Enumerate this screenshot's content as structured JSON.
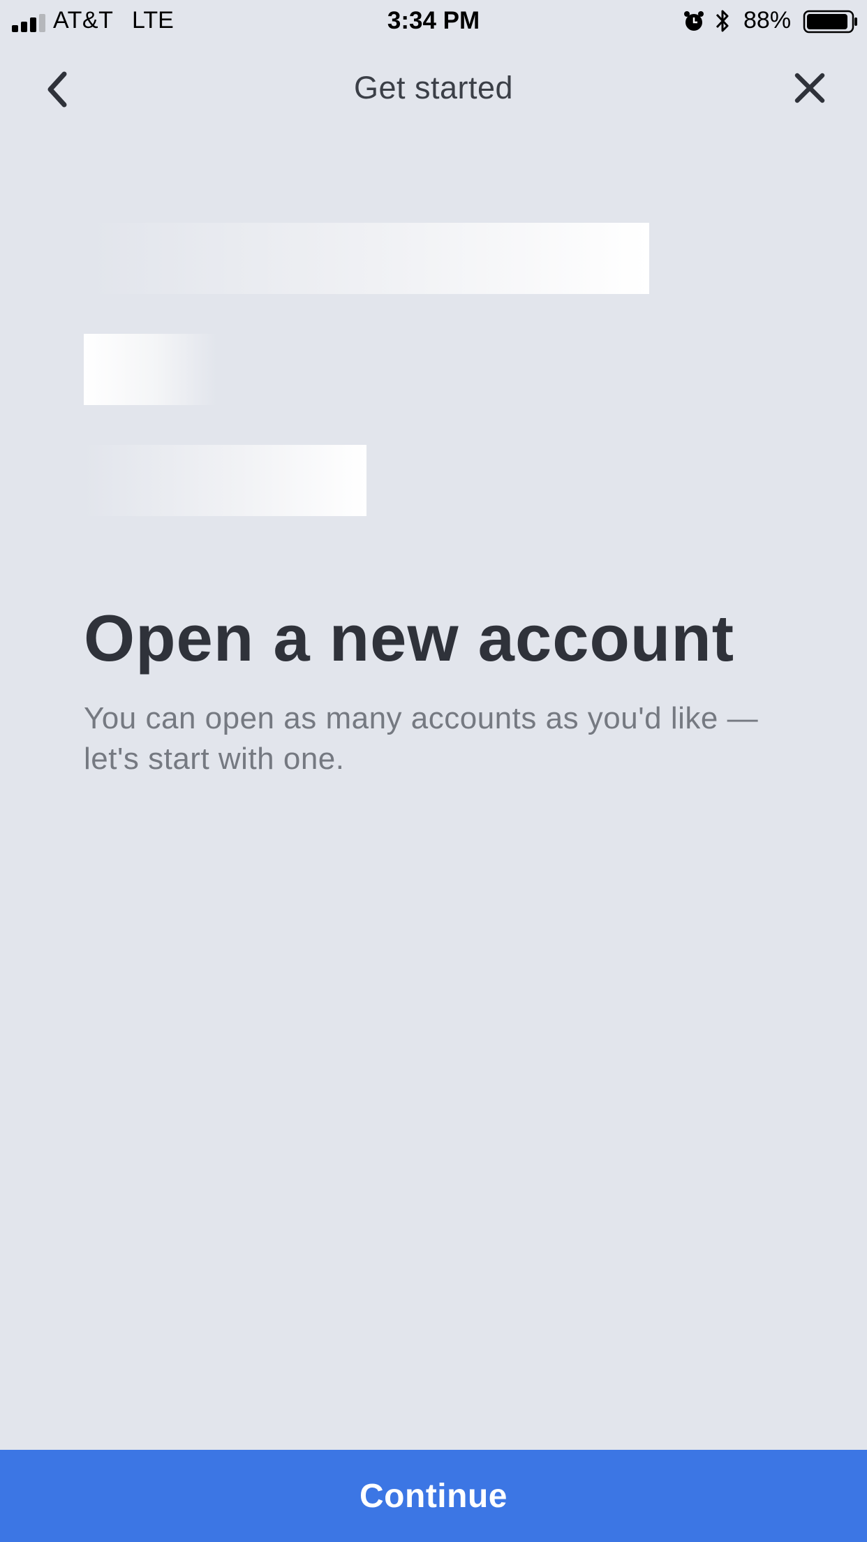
{
  "status_bar": {
    "carrier": "AT&T",
    "network": "LTE",
    "time": "3:34 PM",
    "battery_percent": "88%",
    "signal_bars": 3,
    "signal_bars_total": 4,
    "battery_level": 0.88,
    "icons": [
      "signal-icon",
      "alarm-icon",
      "bluetooth-icon",
      "battery-icon"
    ]
  },
  "nav": {
    "title": "Get started",
    "back_icon": "chevron-left-icon",
    "close_icon": "close-icon"
  },
  "main": {
    "heading": "Open a new account",
    "subtitle": "You can open as many accounts as you'd like — let's start with one."
  },
  "footer": {
    "continue_label": "Continue"
  },
  "colors": {
    "background": "#e2e5ec",
    "heading": "#2f323a",
    "subtitle": "#757981",
    "accent": "#3c76e4"
  }
}
